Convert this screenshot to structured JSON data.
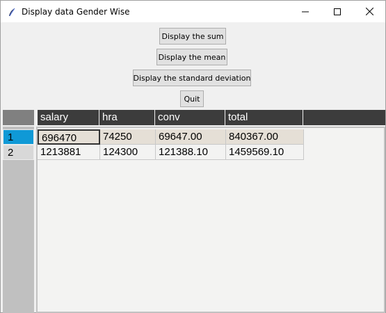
{
  "window": {
    "title": "Display data Gender Wise",
    "controls": [
      "minimize-icon",
      "maximize-icon",
      "close-icon"
    ]
  },
  "buttons": {
    "sum": "Display the sum",
    "mean": "Display the mean",
    "std": "Display the standard deviation",
    "quit": "Quit"
  },
  "table": {
    "columns": [
      "salary",
      "hra",
      "conv",
      "total"
    ],
    "row_labels": [
      "1",
      "2"
    ],
    "rows": [
      [
        "696470",
        "74250",
        "69647.00",
        "840367.00"
      ],
      [
        "1213881",
        "124300",
        "121388.10",
        "1459569.10"
      ]
    ],
    "selected_row": 0,
    "colors": {
      "header_bg": "#3c3c3c",
      "header_fg": "#ffffff",
      "selected_index_bg": "#0f99d6",
      "highlight_row_bg": "#e5dfd6"
    }
  }
}
